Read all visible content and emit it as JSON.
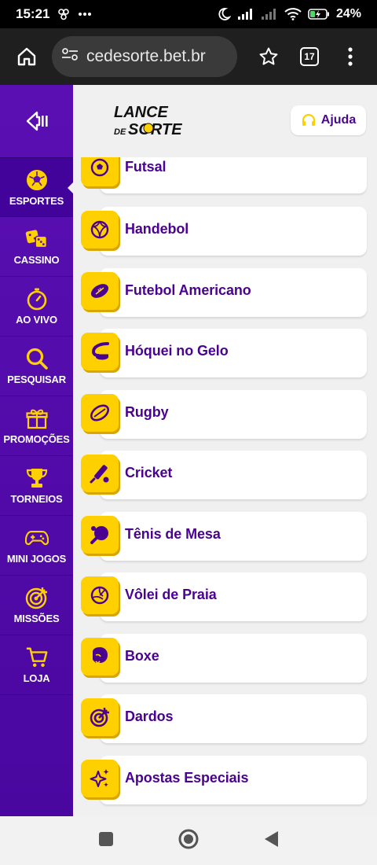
{
  "status_bar": {
    "time": "15:21",
    "battery": "24%"
  },
  "browser": {
    "url": "cedesorte.bet.br",
    "tab_count": "17"
  },
  "header": {
    "logo_line1": "LANCE",
    "logo_line2a": "DE",
    "logo_line2b": "SORTE",
    "help_label": "Ajuda"
  },
  "sidebar": {
    "items": [
      {
        "label": "ESPORTES",
        "icon": "soccer-ball-icon"
      },
      {
        "label": "CASSINO",
        "icon": "dice-icon"
      },
      {
        "label": "AO VIVO",
        "icon": "stopwatch-icon"
      },
      {
        "label": "PESQUISAR",
        "icon": "search-icon"
      },
      {
        "label": "PROMOÇÕES",
        "icon": "gift-icon"
      },
      {
        "label": "TORNEIOS",
        "icon": "trophy-icon"
      },
      {
        "label": "MINI JOGOS",
        "icon": "gamepad-icon"
      },
      {
        "label": "MISSÕES",
        "icon": "target-icon"
      },
      {
        "label": "LOJA",
        "icon": "cart-icon"
      }
    ]
  },
  "sports": [
    {
      "label": "Futsal",
      "icon": "futsal-ball-icon"
    },
    {
      "label": "Handebol",
      "icon": "handball-icon"
    },
    {
      "label": "Futebol Americano",
      "icon": "american-football-icon"
    },
    {
      "label": "Hóquei no Gelo",
      "icon": "ice-hockey-icon"
    },
    {
      "label": "Rugby",
      "icon": "rugby-ball-icon"
    },
    {
      "label": "Cricket",
      "icon": "cricket-icon"
    },
    {
      "label": "Tênis de Mesa",
      "icon": "table-tennis-icon"
    },
    {
      "label": "Vôlei de Praia",
      "icon": "volleyball-icon"
    },
    {
      "label": "Boxe",
      "icon": "boxing-glove-icon"
    },
    {
      "label": "Dardos",
      "icon": "darts-icon"
    },
    {
      "label": "Apostas Especiais",
      "icon": "sparkles-icon"
    }
  ],
  "colors": {
    "brand_purple": "#5a0fb3",
    "text_purple": "#4a0290",
    "accent_yellow": "#ffd000"
  }
}
